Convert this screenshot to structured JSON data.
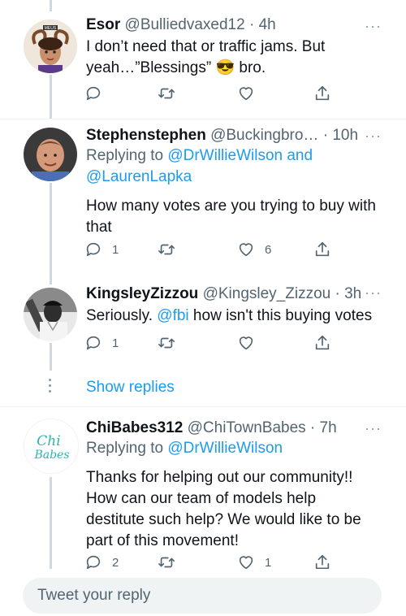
{
  "tweets": [
    {
      "name": "Esor",
      "meta": "@Bulliedvaxed12 · 4h",
      "reply_prefix": "",
      "reply_links": "",
      "text_line1": "I don’t need that or traffic jams.  But",
      "text_line2_pre": "yeah…”Blessings” ",
      "emoji": "😎",
      "text_line2_post": " bro.",
      "reply_count": "",
      "like_count": ""
    },
    {
      "name": "Stephenstephen",
      "meta": "@Buckingbro… · 10h",
      "reply_prefix": "Replying to ",
      "reply_link1": "@DrWillieWilson",
      "reply_join": " and",
      "reply_link2": "@LaurenLapka",
      "text_line1": "How many votes are you trying to buy with",
      "text_line2": "that",
      "reply_count": "1",
      "like_count": "6"
    },
    {
      "name": "KingsleyZizzou",
      "meta": "@Kingsley_Zizzou · 3h",
      "text_pre": "Seriously. ",
      "mention": "@fbi",
      "text_post": " how isn't this buying votes",
      "reply_count": "1",
      "like_count": ""
    },
    {
      "name": "ChiBabes312",
      "meta": "@ChiTownBabes · 7h",
      "reply_prefix": "Replying to ",
      "reply_link1": "@DrWillieWilson",
      "text_line1": "Thanks for helping out our community!!",
      "text_line2": "How can our team of models help",
      "text_line3": "destitute such help? We would like to be",
      "text_line4": "part of this movement!",
      "reply_count": "2",
      "like_count": "1",
      "avatar_text1": "Chi",
      "avatar_text2": "Babes"
    }
  ],
  "show_replies": "Show replies",
  "more_glyph": "···",
  "avatar1_banner": "MEUS",
  "composer": {
    "placeholder": "Tweet your reply"
  },
  "colors": {
    "link": "#1d9bf0",
    "secondary": "#536471",
    "line": "#cfd9de"
  },
  "icons": [
    "reply-icon",
    "retweet-icon",
    "like-icon",
    "share-icon",
    "more-icon"
  ]
}
